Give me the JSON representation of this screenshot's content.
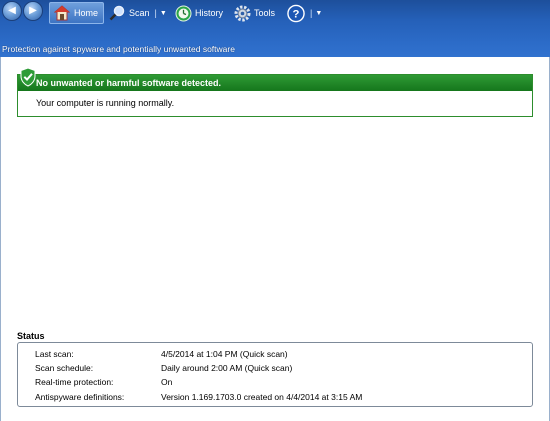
{
  "toolbar": {
    "home_label": "Home",
    "scan_label": "Scan",
    "history_label": "History",
    "tools_label": "Tools",
    "help_glyph": "?",
    "icons": {
      "back": "back-arrow-icon",
      "forward": "forward-arrow-icon",
      "home": "home-icon",
      "scan": "magnifier-icon",
      "history": "history-clock-icon",
      "tools": "gear-icon",
      "help": "help-icon",
      "dropdown": "chevron-down-icon"
    }
  },
  "subtitle": "Protection against spyware and potentially unwanted software",
  "alert": {
    "heading": "No unwanted or harmful software detected.",
    "message": "Your computer is running normally.",
    "icon": "shield-check-icon",
    "color": "#1a7f23"
  },
  "status": {
    "title": "Status",
    "rows": [
      {
        "label": "Last scan:",
        "value": "4/5/2014 at 1:04 PM (Quick scan)"
      },
      {
        "label": "Scan schedule:",
        "value": "Daily around 2:00 AM (Quick scan)"
      },
      {
        "label": "Real-time protection:",
        "value": "On"
      },
      {
        "label": "Antispyware definitions:",
        "value": "Version 1.169.1703.0 created on 4/4/2014 at 3:15 AM"
      }
    ]
  },
  "colors": {
    "chrome": "#2a66c1",
    "alert_green": "#15761c"
  }
}
